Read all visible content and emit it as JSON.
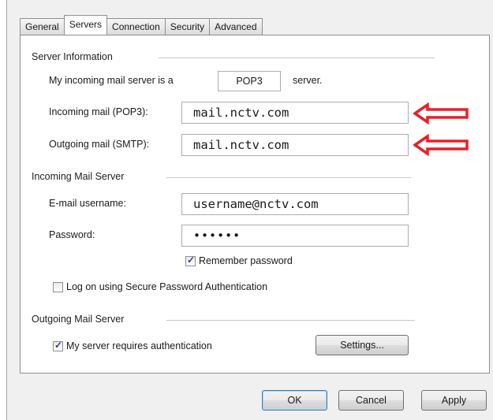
{
  "tabs": [
    {
      "label": "General"
    },
    {
      "label": "Servers"
    },
    {
      "label": "Connection"
    },
    {
      "label": "Security"
    },
    {
      "label": "Advanced"
    }
  ],
  "server_info": {
    "title": "Server Information",
    "incoming_type_prefix": "My incoming mail server is a",
    "incoming_type_value": "POP3",
    "incoming_type_suffix": "server.",
    "incoming_label": "Incoming mail (POP3):",
    "incoming_value": "mail.nctv.com",
    "outgoing_label": "Outgoing mail (SMTP):",
    "outgoing_value": "mail.nctv.com"
  },
  "incoming_server": {
    "title": "Incoming Mail Server",
    "username_label": "E-mail username:",
    "username_value": "username@nctv.com",
    "password_label": "Password:",
    "password_value": "••••••",
    "remember_label": "Remember password",
    "remember_checked": true,
    "spa_label": "Log on using Secure Password Authentication",
    "spa_checked": false
  },
  "outgoing_server": {
    "title": "Outgoing Mail Server",
    "auth_label": "My server requires authentication",
    "auth_checked": true,
    "settings_label": "Settings..."
  },
  "buttons": {
    "ok": "OK",
    "cancel": "Cancel",
    "apply": "Apply"
  },
  "colors": {
    "arrow": "#e8202a"
  }
}
